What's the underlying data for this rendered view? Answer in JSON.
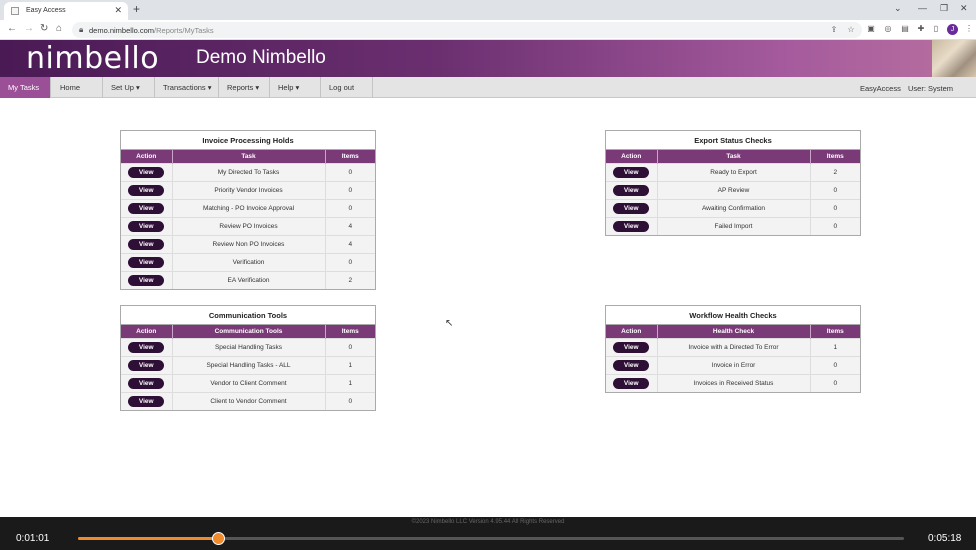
{
  "browser": {
    "tab_title": "Easy Access",
    "url_host": "demo.nimbello.com",
    "url_path": "/Reports/MyTasks",
    "profile_initial": "J"
  },
  "header": {
    "logo": "nimbello",
    "company": "Demo Nimbello"
  },
  "menu": {
    "items": [
      {
        "label": "My Tasks"
      },
      {
        "label": "Home"
      },
      {
        "label": "Set Up ▾"
      },
      {
        "label": "Transactions ▾"
      },
      {
        "label": "Reports ▾"
      },
      {
        "label": "Help ▾"
      },
      {
        "label": "Log out"
      }
    ],
    "app_name": "EasyAccess",
    "user": "User: System"
  },
  "panels": {
    "invoice": {
      "title": "Invoice Processing Holds",
      "headers": [
        "Action",
        "Task",
        "Items"
      ],
      "rows": [
        {
          "action": "View",
          "task": "My Directed To Tasks",
          "items": "0"
        },
        {
          "action": "View",
          "task": "Priority Vendor Invoices",
          "items": "0"
        },
        {
          "action": "View",
          "task": "Matching - PO Invoice Approval",
          "items": "0"
        },
        {
          "action": "View",
          "task": "Review PO Invoices",
          "items": "4"
        },
        {
          "action": "View",
          "task": "Review Non PO Invoices",
          "items": "4"
        },
        {
          "action": "View",
          "task": "Verification",
          "items": "0"
        },
        {
          "action": "View",
          "task": "EA Verification",
          "items": "2"
        }
      ]
    },
    "export": {
      "title": "Export Status Checks",
      "headers": [
        "Action",
        "Task",
        "Items"
      ],
      "rows": [
        {
          "action": "View",
          "task": "Ready to Export",
          "items": "2"
        },
        {
          "action": "View",
          "task": "AP Review",
          "items": "0"
        },
        {
          "action": "View",
          "task": "Awaiting Confirmation",
          "items": "0"
        },
        {
          "action": "View",
          "task": "Failed Import",
          "items": "0"
        }
      ]
    },
    "communication": {
      "title": "Communication Tools",
      "headers": [
        "Action",
        "Communication Tools",
        "Items"
      ],
      "rows": [
        {
          "action": "View",
          "task": "Special Handling Tasks",
          "items": "0"
        },
        {
          "action": "View",
          "task": "Special Handling Tasks - ALL",
          "items": "1"
        },
        {
          "action": "View",
          "task": "Vendor to Client Comment",
          "items": "1"
        },
        {
          "action": "View",
          "task": "Client to Vendor Comment",
          "items": "0"
        }
      ]
    },
    "workflow": {
      "title": "Workflow Health Checks",
      "headers": [
        "Action",
        "Health Check",
        "Items"
      ],
      "rows": [
        {
          "action": "View",
          "task": "Invoice with a Directed To Error",
          "items": "1"
        },
        {
          "action": "View",
          "task": "Invoice in Error",
          "items": "0"
        },
        {
          "action": "View",
          "task": "Invoices in Received Status",
          "items": "0"
        }
      ]
    }
  },
  "footer": {
    "copyright": "©2023 Nimbello LLC Version 4.95.44 All Rights Reserved"
  },
  "player": {
    "current_time": "0:01:01",
    "duration": "0:05:18",
    "progress": 0.17
  }
}
